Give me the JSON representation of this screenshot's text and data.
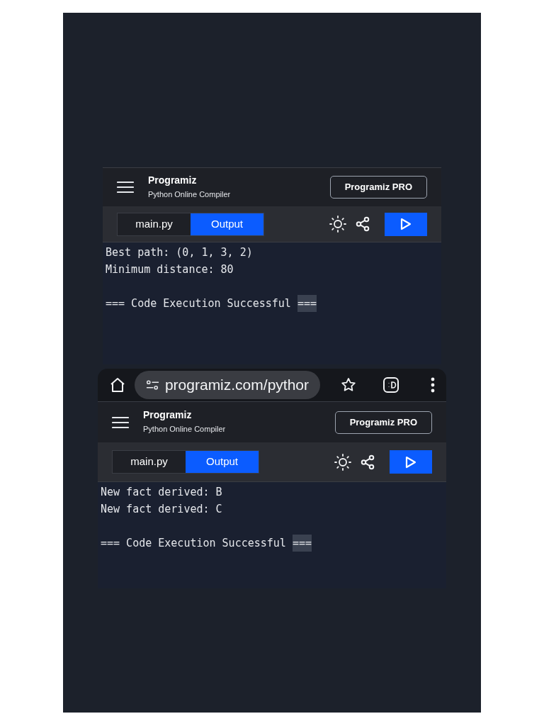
{
  "panels": [
    {
      "brand": "Programiz",
      "subtitle": "Python Online Compiler",
      "pro_button": "Programiz PRO",
      "tabs": [
        {
          "label": "main.py",
          "selected": false
        },
        {
          "label": "Output",
          "selected": true
        }
      ],
      "output_lines": [
        "Best path: (0, 1, 3, 2)",
        "Minimum distance: 80"
      ],
      "status": {
        "text": "=== Code Execution Successful",
        "highlighted": "==="
      }
    },
    {
      "browser_bar": {
        "url": "programiz.com/pythor"
      },
      "brand": "Programiz",
      "subtitle": "Python Online Compiler",
      "pro_button": "Programiz PRO",
      "tabs": [
        {
          "label": "main.py",
          "selected": false
        },
        {
          "label": "Output",
          "selected": true
        }
      ],
      "output_lines": [
        "New fact derived: B",
        "New fact derived: C"
      ],
      "status": {
        "text": "=== Code Execution Successful",
        "highlighted": "==="
      }
    }
  ]
}
